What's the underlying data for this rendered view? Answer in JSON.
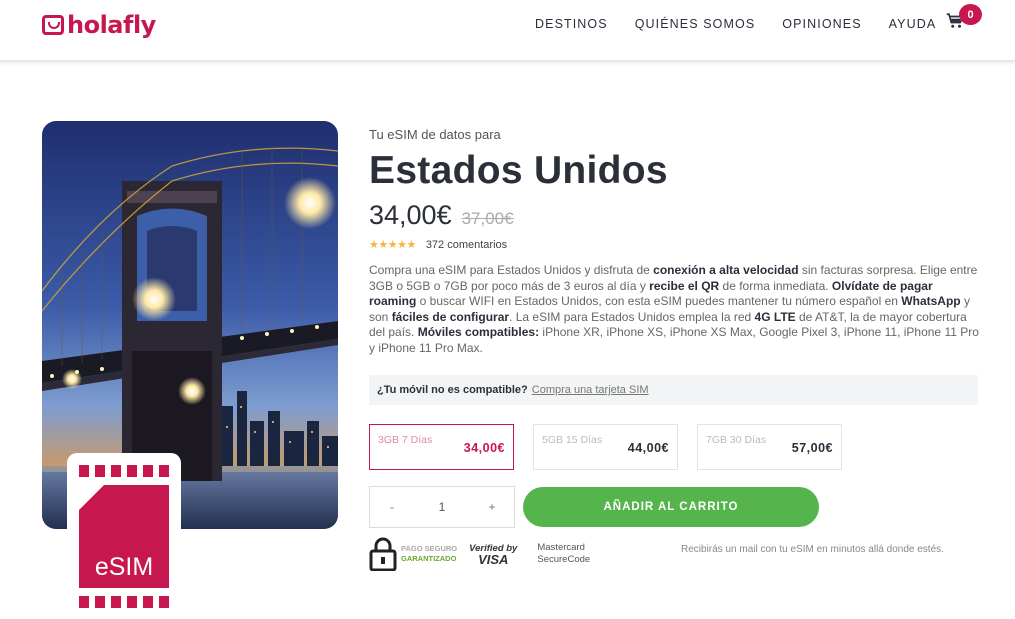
{
  "brand": {
    "name": "holafly",
    "color": "#c7174f"
  },
  "nav": {
    "items": [
      "DESTINOS",
      "QUIÉNES SOMOS",
      "OPINIONES",
      "AYUDA"
    ],
    "cart_count": "0"
  },
  "product": {
    "subtitle": "Tu eSIM de datos para",
    "title": "Estados Unidos",
    "price": "34,00€",
    "old_price": "37,00€",
    "stars": "★★★★★",
    "reviews": "372 comentarios",
    "esim_label": "eSIM",
    "description": {
      "p1": "Compra una eSIM para Estados Unidos y disfruta de ",
      "b1": "conexión a alta velocidad",
      "p2": " sin facturas sorpresa. Elige entre 3GB o 5GB o 7GB por poco más de 3 euros al día y ",
      "b2": "recibe el QR",
      "p3": " de forma inmediata. ",
      "b3": "Olvídate de pagar roaming",
      "p4": " o buscar WIFI en Estados Unidos, con esta eSIM puedes mantener tu número español en ",
      "b4": "WhatsApp",
      "p5": " y son ",
      "b5": "fáciles de configurar",
      "p6": ". La eSIM para Estados Unidos emplea la red ",
      "b6": "4G LTE",
      "p7": " de AT&T, la de mayor cobertura del país. ",
      "b7": "Móviles compatibles:",
      "p8": " iPhone XR, iPhone XS, iPhone XS Max, Google Pixel 3, iPhone 11, iPhone 11 Pro y iPhone 11 Pro Max."
    }
  },
  "compat": {
    "question": "¿Tu móvil no es compatible?",
    "link": "Compra una tarjeta SIM"
  },
  "plans": [
    {
      "name": "3GB 7 Días",
      "price": "34,00€",
      "selected": true
    },
    {
      "name": "5GB 15 Días",
      "price": "44,00€",
      "selected": false
    },
    {
      "name": "7GB 30 Días",
      "price": "57,00€",
      "selected": false
    }
  ],
  "quantity": {
    "minus": "-",
    "value": "1",
    "plus": "+"
  },
  "add_to_cart": "AÑADIR AL CARRITO",
  "trust": {
    "secure_line1": "PAGO SEGURO",
    "secure_line2": "GARANTIZADO",
    "visa_line1": "Verified by",
    "visa_line2": "VISA",
    "mc_line1": "Mastercard",
    "mc_line2": "SecureCode"
  },
  "delivery": "Recibirás un mail con tu eSIM en minutos allá donde estés.",
  "colors": {
    "accent": "#c7174f",
    "button_green": "#56b44c",
    "star": "#f4b63f"
  },
  "icons": {
    "cart": "shopping-cart-icon",
    "lock": "lock-icon",
    "logo": "holafly-logo-icon"
  }
}
